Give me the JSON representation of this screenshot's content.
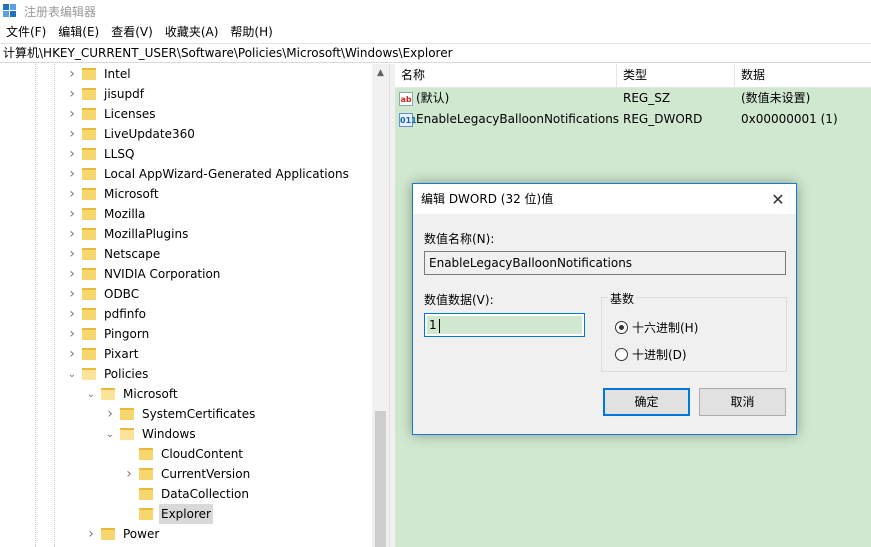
{
  "window": {
    "title": "注册表编辑器"
  },
  "menu": {
    "items": [
      "文件(F)",
      "编辑(E)",
      "查看(V)",
      "收藏夹(A)",
      "帮助(H)"
    ]
  },
  "address": "计算机\\HKEY_CURRENT_USER\\Software\\Policies\\Microsoft\\Windows\\Explorer",
  "tree": {
    "items": [
      {
        "label": "Intel",
        "level": 0,
        "expanded": false
      },
      {
        "label": "jisupdf",
        "level": 0,
        "expanded": false
      },
      {
        "label": "Licenses",
        "level": 0,
        "expanded": false
      },
      {
        "label": "LiveUpdate360",
        "level": 0,
        "expanded": false
      },
      {
        "label": "LLSQ",
        "level": 0,
        "expanded": false
      },
      {
        "label": "Local AppWizard-Generated Applications",
        "level": 0,
        "expanded": false
      },
      {
        "label": "Microsoft",
        "level": 0,
        "expanded": false
      },
      {
        "label": "Mozilla",
        "level": 0,
        "expanded": false
      },
      {
        "label": "MozillaPlugins",
        "level": 0,
        "expanded": false
      },
      {
        "label": "Netscape",
        "level": 0,
        "expanded": false
      },
      {
        "label": "NVIDIA Corporation",
        "level": 0,
        "expanded": false
      },
      {
        "label": "ODBC",
        "level": 0,
        "expanded": false
      },
      {
        "label": "pdfinfo",
        "level": 0,
        "expanded": false
      },
      {
        "label": "Pingorn",
        "level": 0,
        "expanded": false
      },
      {
        "label": "Pixart",
        "level": 0,
        "expanded": false
      },
      {
        "label": "Policies",
        "level": 0,
        "expanded": true
      },
      {
        "label": "Microsoft",
        "level": 1,
        "expanded": true
      },
      {
        "label": "SystemCertificates",
        "level": 2,
        "expanded": false
      },
      {
        "label": "Windows",
        "level": 2,
        "expanded": true
      },
      {
        "label": "CloudContent",
        "level": 3,
        "expanded": null
      },
      {
        "label": "CurrentVersion",
        "level": 3,
        "expanded": false
      },
      {
        "label": "DataCollection",
        "level": 3,
        "expanded": null
      },
      {
        "label": "Explorer",
        "level": 3,
        "expanded": null,
        "selected": true
      },
      {
        "label": "Power",
        "level": 1,
        "expanded": false
      }
    ]
  },
  "values": {
    "columns": [
      "名称",
      "类型",
      "数据"
    ],
    "rows": [
      {
        "icon": "ab",
        "name": "(默认)",
        "type": "REG_SZ",
        "data": "(数值未设置)"
      },
      {
        "icon": "011",
        "name": "EnableLegacyBalloonNotifications",
        "type": "REG_DWORD",
        "data": "0x00000001 (1)"
      }
    ]
  },
  "dialog": {
    "title": "编辑 DWORD (32 位)值",
    "name_label": "数值名称(N):",
    "name_value": "EnableLegacyBalloonNotifications",
    "data_label": "数值数据(V):",
    "data_value": "1",
    "base_label": "基数",
    "hex_label": "十六进制(H)",
    "dec_label": "十进制(D)",
    "hex_selected": true,
    "ok_label": "确定",
    "cancel_label": "取消",
    "close_glyph": "✕"
  },
  "colors": {
    "values_bg": "#cfe8cf",
    "selection": "#d9d9d9",
    "accent": "#0078d7"
  }
}
